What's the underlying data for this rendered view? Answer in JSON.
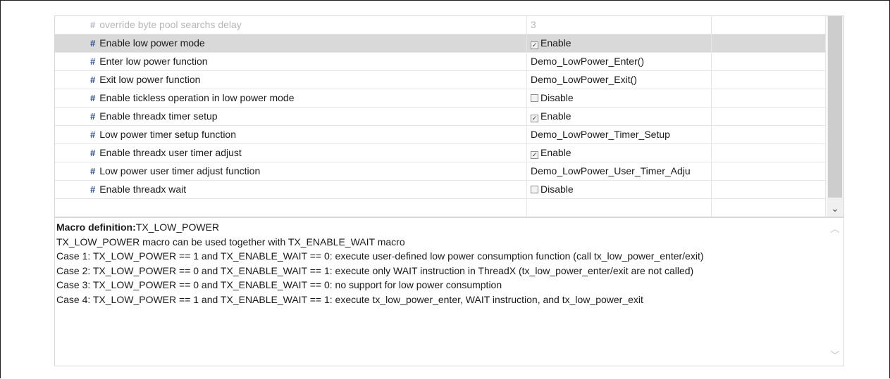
{
  "rows": [
    {
      "name": "override byte pool searchs delay",
      "value": "3",
      "checkbox": null,
      "faded": true,
      "selected": false
    },
    {
      "name": "Enable low power mode",
      "value": "Enable",
      "checkbox": true,
      "faded": false,
      "selected": true
    },
    {
      "name": "Enter low power function",
      "value": "Demo_LowPower_Enter()",
      "checkbox": null,
      "faded": false,
      "selected": false
    },
    {
      "name": "Exit low power function",
      "value": "Demo_LowPower_Exit()",
      "checkbox": null,
      "faded": false,
      "selected": false
    },
    {
      "name": "Enable tickless operation in low power mode",
      "value": "Disable",
      "checkbox": false,
      "faded": false,
      "selected": false
    },
    {
      "name": "Enable threadx timer setup",
      "value": "Enable",
      "checkbox": true,
      "faded": false,
      "selected": false
    },
    {
      "name": "Low power timer setup function",
      "value": "Demo_LowPower_Timer_Setup",
      "checkbox": null,
      "faded": false,
      "selected": false
    },
    {
      "name": "Enable threadx user timer adjust",
      "value": "Enable",
      "checkbox": true,
      "faded": false,
      "selected": false
    },
    {
      "name": "Low power user timer adjust function",
      "value": "Demo_LowPower_User_Timer_Adju",
      "checkbox": null,
      "faded": false,
      "selected": false
    },
    {
      "name": "Enable threadx wait",
      "value": "Disable",
      "checkbox": false,
      "faded": false,
      "selected": false
    }
  ],
  "icons": {
    "row_marker": "#",
    "scroll_down": "chevron-down-icon",
    "scroll_up": "chevron-up-icon"
  },
  "description": {
    "heading_label": "Macro definition:",
    "heading_value": "TX_LOW_POWER",
    "lines": [
      "TX_LOW_POWER macro can be used together with TX_ENABLE_WAIT macro",
      "Case 1: TX_LOW_POWER == 1 and TX_ENABLE_WAIT == 0: execute user-defined low power consumption function (call tx_low_power_enter/exit)",
      "Case 2: TX_LOW_POWER == 0 and TX_ENABLE_WAIT == 1: execute only WAIT instruction in ThreadX (tx_low_power_enter/exit are not called)",
      "Case 3: TX_LOW_POWER == 0 and TX_ENABLE_WAIT == 0: no support for low power consumption",
      "Case 4: TX_LOW_POWER == 1 and TX_ENABLE_WAIT == 1: execute tx_low_power_enter, WAIT instruction, and tx_low_power_exit"
    ]
  },
  "colors": {
    "selected_row": "#d9d9d9",
    "marker": "#2b4a8b"
  }
}
